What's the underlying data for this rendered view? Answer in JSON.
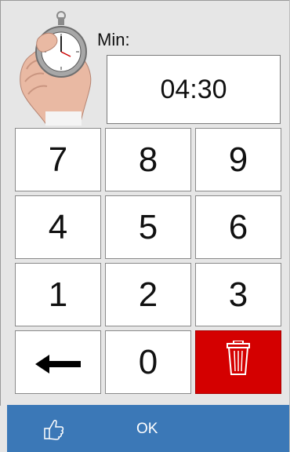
{
  "timer": {
    "label": "Min:",
    "value": "04:30"
  },
  "keypad": {
    "keys": [
      "7",
      "8",
      "9",
      "4",
      "5",
      "6",
      "1",
      "2",
      "3"
    ],
    "zero": "0"
  },
  "actions": {
    "ok_label": "OK",
    "delete_color": "#d40000",
    "ok_color": "#3b78b7"
  },
  "icons": {
    "header": "stopwatch-in-hand-icon",
    "backspace": "left-arrow-icon",
    "delete": "trash-icon",
    "confirm": "thumbs-up-icon"
  }
}
